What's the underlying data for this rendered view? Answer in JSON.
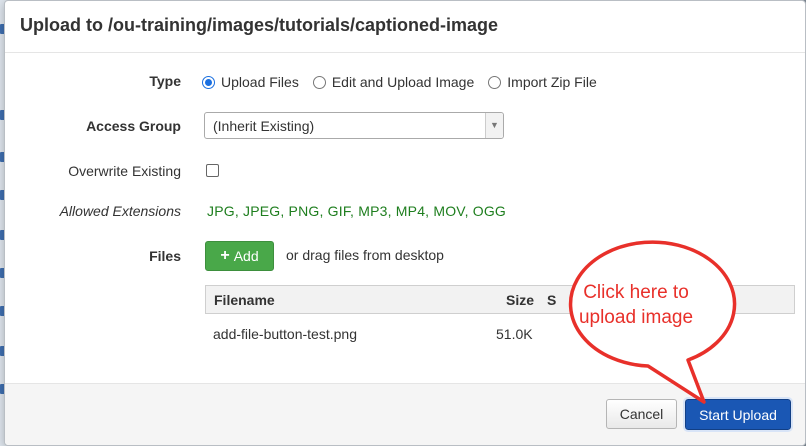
{
  "dialog": {
    "title": "Upload to /ou-training/images/tutorials/captioned-image"
  },
  "form": {
    "type_label": "Type",
    "type_options": [
      "Upload Files",
      "Edit and Upload Image",
      "Import Zip File"
    ],
    "type_selected": "Upload Files",
    "access_group_label": "Access Group",
    "access_group_value": "(Inherit Existing)",
    "overwrite_label": "Overwrite Existing",
    "overwrite_checked": false,
    "allowed_extensions_label": "Allowed Extensions",
    "allowed_extensions": "JPG,  JPEG,  PNG,  GIF,  MP3,  MP4,  MOV,  OGG",
    "files_label": "Files",
    "add_button_label": "Add",
    "drag_hint": "or drag files from desktop"
  },
  "files_table": {
    "columns": [
      "Filename",
      "Size",
      "S"
    ],
    "rows": [
      {
        "filename": "add-file-button-test.png",
        "size": "51.0K"
      }
    ]
  },
  "footer": {
    "cancel_label": "Cancel",
    "start_upload_label": "Start Upload"
  },
  "annotation": {
    "line1": "Click here to",
    "line2": "upload image",
    "color": "#e8302a"
  },
  "colors": {
    "extensions_text": "#1e7e1e",
    "add_button": "#49a849",
    "primary_button": "#1a57b4",
    "radio_checked": "#1a6fe0"
  },
  "icons": {
    "add_button_icon": "plus-icon",
    "select_icon": "caret-down-icon"
  }
}
